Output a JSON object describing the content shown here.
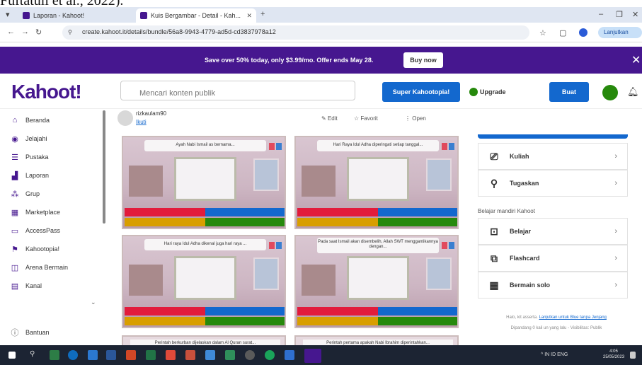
{
  "caption": "Fuftatuli et al., 2022).",
  "browser": {
    "tabs": [
      {
        "title": "Laporan - Kahoot!",
        "active": false
      },
      {
        "title": "Kuis Bergambar - Detail - Kah...",
        "active": true
      }
    ],
    "new_tab": "+",
    "url": "create.kahoot.it/details/bundle/56a8-9943-4779-ad5d-cd3837978a12",
    "resume_button": "Lanjutkan"
  },
  "promo": {
    "text": "Save over 50% today, only $3.99/mo. Offer ends May 28.",
    "buy_label": "Buy now",
    "accent": "#46178f"
  },
  "header": {
    "logo": "Kahoot!",
    "search_placeholder": "Mencari konten publik",
    "super_label": "Super Kahootopia!",
    "upgrade_label": "Upgrade",
    "create_label": "Buat"
  },
  "sidebar": {
    "items": [
      {
        "label": "Beranda",
        "icon": "home-icon"
      },
      {
        "label": "Jelajahi",
        "icon": "compass-icon"
      },
      {
        "label": "Pustaka",
        "icon": "library-icon"
      },
      {
        "label": "Laporan",
        "icon": "reports-icon"
      },
      {
        "label": "Grup",
        "icon": "group-icon"
      },
      {
        "label": "Marketplace",
        "icon": "marketplace-icon"
      },
      {
        "label": "AccessPass",
        "icon": "accesspass-icon"
      },
      {
        "label": "Kahootopia!",
        "icon": "kahootopia-icon"
      },
      {
        "label": "Arena Bermain",
        "icon": "arena-icon"
      },
      {
        "label": "Kanal",
        "icon": "channel-icon"
      }
    ],
    "help_label": "Bantuan"
  },
  "owner": {
    "name": "rizkaulam90",
    "link": "Ikuti"
  },
  "actions": {
    "edit": "Edit",
    "favorite": "Favorit",
    "open": "Open"
  },
  "questions": [
    {
      "title": "Ayah Nabi Ismail as bernama..."
    },
    {
      "title": "Hari Raya Idul Adha diperingati setiap tanggal..."
    },
    {
      "title": "Hari raya Idul Adha dikenal juga hari raya ..."
    },
    {
      "title": "Pada saat Ismail akan disembelih, Allah SWT menggantikannya dengan..."
    },
    {
      "title": "Perintah berkurban dijelaskan dalam Al Quran surat..."
    },
    {
      "title": "Perintah pertama apakah Nabi Ibrahim diperintahkan..."
    }
  ],
  "right_panel": {
    "items_top": [
      {
        "label": "Kuliah",
        "icon": "lecture-icon"
      },
      {
        "label": "Tugaskan",
        "icon": "assign-icon"
      }
    ],
    "heading": "Belajar mandiri Kahoot",
    "items_bottom": [
      {
        "label": "Belajar",
        "icon": "learn-icon"
      },
      {
        "label": "Flashcard",
        "icon": "flashcard-icon"
      },
      {
        "label": "Bermain solo",
        "icon": "solo-icon"
      }
    ],
    "footer_prefix": "Halo, kit asserta.",
    "footer_link": "Lanjutkan untuk Blue tanpa Jenjang",
    "footer_line2": "Dipandang 0 kali un yang lalu - Visibilitas: Publik"
  },
  "taskbar": {
    "tray": "^ IN ID ENG",
    "time": "4:05",
    "date": "25/05/2023"
  },
  "colors": {
    "kahoot_purple": "#46178f",
    "kahoot_blue": "#1368ce",
    "answer_red": "#e21b3c",
    "answer_blue": "#1368ce",
    "answer_yellow": "#d89e00",
    "answer_green": "#26890c"
  }
}
